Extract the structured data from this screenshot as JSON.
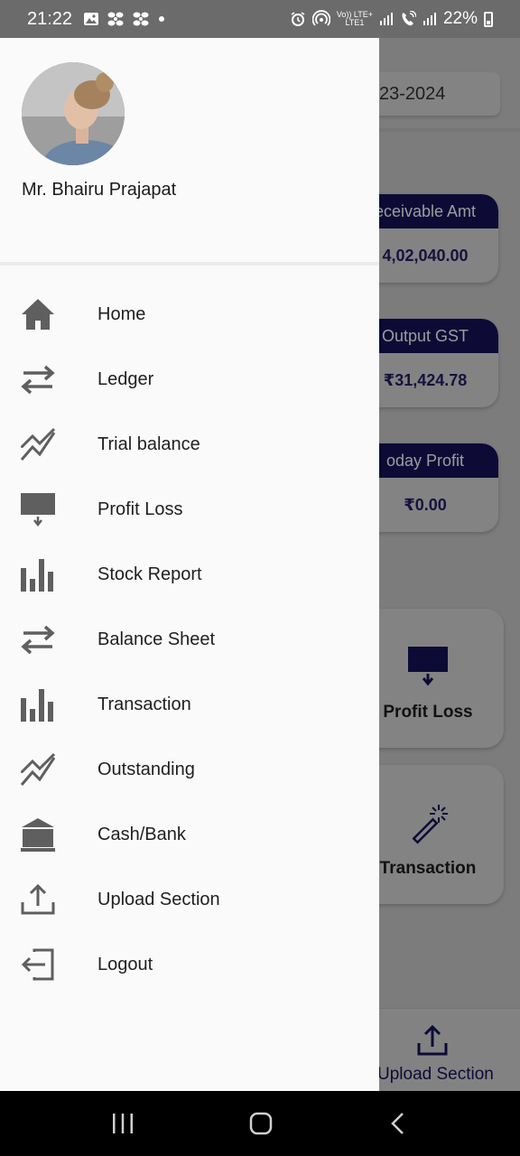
{
  "status_bar": {
    "time": "21:22",
    "network_label": "Vo)) LTE+",
    "network_sublabel": "LTE1",
    "battery": "22%"
  },
  "background": {
    "financial_year": "23-2024",
    "cards": [
      {
        "caption": "eceivable Amt",
        "value": "4,02,040.00"
      },
      {
        "caption": "Output GST",
        "value": "₹31,424.78"
      },
      {
        "caption": "oday Profit",
        "value": "₹0.00"
      }
    ],
    "tiles": [
      {
        "label": "Profit Loss",
        "icon": "monitor-down-icon"
      },
      {
        "label": "Transaction",
        "icon": "magic-wand-icon"
      }
    ],
    "bottom_tab": {
      "label": "Upload Section",
      "icon": "upload-icon"
    }
  },
  "drawer": {
    "user_name": "Mr. Bhairu Prajapat",
    "items": [
      {
        "label": "Home",
        "icon": "home-icon"
      },
      {
        "label": "Ledger",
        "icon": "swap-arrows-icon"
      },
      {
        "label": "Trial balance",
        "icon": "trend-chart-icon"
      },
      {
        "label": "Profit Loss",
        "icon": "monitor-down-icon"
      },
      {
        "label": "Stock Report",
        "icon": "bar-chart-icon"
      },
      {
        "label": "Balance Sheet",
        "icon": "swap-arrows-icon"
      },
      {
        "label": "Transaction",
        "icon": "bar-chart-icon"
      },
      {
        "label": "Outstanding",
        "icon": "trend-chart-icon"
      },
      {
        "label": "Cash/Bank",
        "icon": "bank-icon"
      },
      {
        "label": "Upload Section",
        "icon": "upload-icon"
      },
      {
        "label": "Logout",
        "icon": "logout-icon"
      }
    ]
  },
  "colors": {
    "drawer_bg": "#fafafa",
    "icon_gray": "#5f5f5f",
    "accent_navy": "#0d0b36"
  }
}
